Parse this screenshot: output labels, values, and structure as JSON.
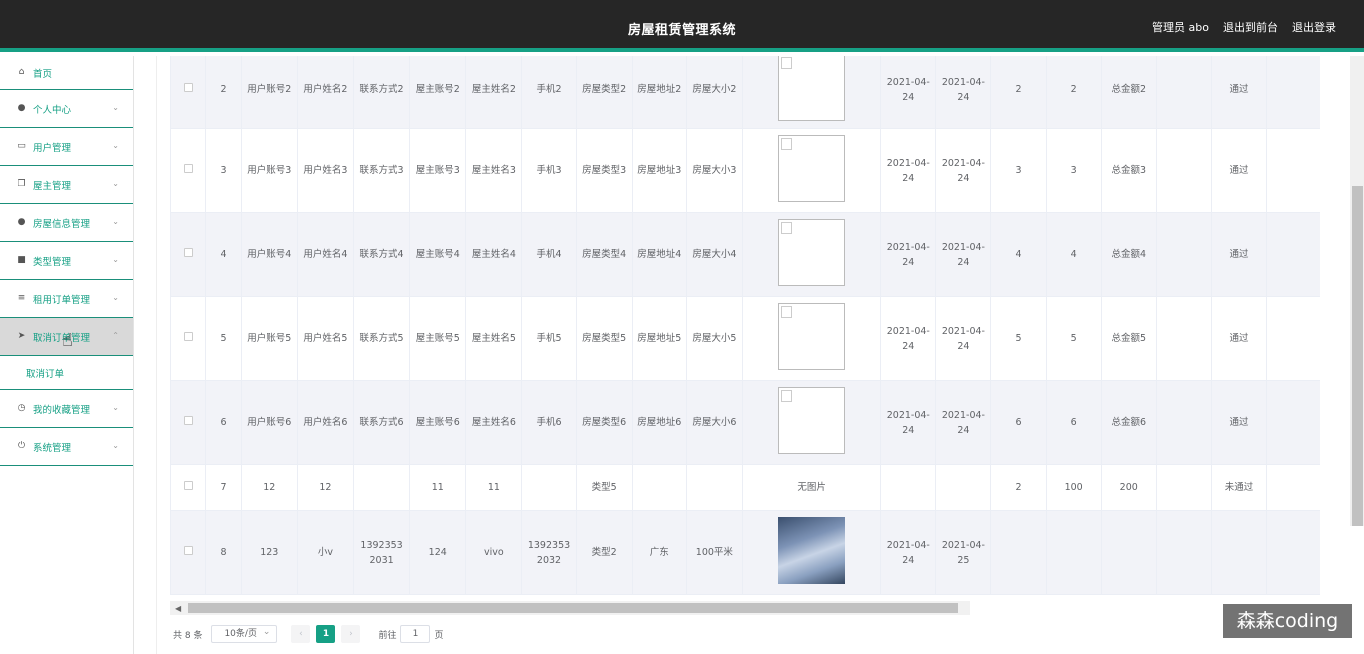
{
  "header": {
    "title": "房屋租赁管理系统",
    "admin": "管理员 abo",
    "to_front": "退出到前台",
    "logout": "退出登录"
  },
  "sidebar": {
    "items": [
      {
        "label": "首页",
        "icon": "home-icon"
      },
      {
        "label": "个人中心",
        "icon": "user-icon"
      },
      {
        "label": "用户管理",
        "icon": "card-icon"
      },
      {
        "label": "屋主管理",
        "icon": "copy-icon"
      },
      {
        "label": "房屋信息管理",
        "icon": "person-icon"
      },
      {
        "label": "类型管理",
        "icon": "briefcase-icon"
      },
      {
        "label": "租用订单管理",
        "icon": "sliders-icon"
      },
      {
        "label": "取消订单管理",
        "icon": "send-icon"
      },
      {
        "label": "我的收藏管理",
        "icon": "clock-icon"
      },
      {
        "label": "系统管理",
        "icon": "power-icon"
      }
    ],
    "submenu_label": "取消订单"
  },
  "table": {
    "rows": [
      {
        "idx": "2",
        "c1": "用户账号2",
        "c2": "用户姓名2",
        "c3": "联系方式2",
        "c4": "屋主账号2",
        "c5": "屋主姓名2",
        "c6": "手机2",
        "c7": "房屋类型2",
        "c8": "房屋地址2",
        "c9": "房屋大小2",
        "img": "broken",
        "d1": "2021-04-24",
        "d2": "2021-04-24",
        "n1": "2",
        "n2": "2",
        "total": "总金额2",
        "c10": "",
        "status": "通过"
      },
      {
        "idx": "3",
        "c1": "用户账号3",
        "c2": "用户姓名3",
        "c3": "联系方式3",
        "c4": "屋主账号3",
        "c5": "屋主姓名3",
        "c6": "手机3",
        "c7": "房屋类型3",
        "c8": "房屋地址3",
        "c9": "房屋大小3",
        "img": "broken",
        "d1": "2021-04-24",
        "d2": "2021-04-24",
        "n1": "3",
        "n2": "3",
        "total": "总金额3",
        "c10": "",
        "status": "通过"
      },
      {
        "idx": "4",
        "c1": "用户账号4",
        "c2": "用户姓名4",
        "c3": "联系方式4",
        "c4": "屋主账号4",
        "c5": "屋主姓名4",
        "c6": "手机4",
        "c7": "房屋类型4",
        "c8": "房屋地址4",
        "c9": "房屋大小4",
        "img": "broken",
        "d1": "2021-04-24",
        "d2": "2021-04-24",
        "n1": "4",
        "n2": "4",
        "total": "总金额4",
        "c10": "",
        "status": "通过"
      },
      {
        "idx": "5",
        "c1": "用户账号5",
        "c2": "用户姓名5",
        "c3": "联系方式5",
        "c4": "屋主账号5",
        "c5": "屋主姓名5",
        "c6": "手机5",
        "c7": "房屋类型5",
        "c8": "房屋地址5",
        "c9": "房屋大小5",
        "img": "broken",
        "d1": "2021-04-24",
        "d2": "2021-04-24",
        "n1": "5",
        "n2": "5",
        "total": "总金额5",
        "c10": "",
        "status": "通过"
      },
      {
        "idx": "6",
        "c1": "用户账号6",
        "c2": "用户姓名6",
        "c3": "联系方式6",
        "c4": "屋主账号6",
        "c5": "屋主姓名6",
        "c6": "手机6",
        "c7": "房屋类型6",
        "c8": "房屋地址6",
        "c9": "房屋大小6",
        "img": "broken",
        "d1": "2021-04-24",
        "d2": "2021-04-24",
        "n1": "6",
        "n2": "6",
        "total": "总金额6",
        "c10": "",
        "status": "通过"
      },
      {
        "idx": "7",
        "c1": "12",
        "c2": "12",
        "c3": "",
        "c4": "11",
        "c5": "11",
        "c6": "",
        "c7": "类型5",
        "c8": "",
        "c9": "",
        "img": "none",
        "img_text": "无图片",
        "d1": "",
        "d2": "",
        "n1": "2",
        "n2": "100",
        "total": "200",
        "c10": "",
        "status": "未通过"
      },
      {
        "idx": "8",
        "c1": "123",
        "c2": "小v",
        "c3": "13923532031",
        "c4": "124",
        "c5": "vivo",
        "c6": "13923532032",
        "c7": "类型2",
        "c8": "广东",
        "c9": "100平米",
        "img": "photo",
        "d1": "2021-04-24",
        "d2": "2021-04-25",
        "n1": "",
        "n2": "",
        "total": "",
        "c10": "",
        "status": ""
      }
    ],
    "op_icon": "edit-icon"
  },
  "pagination": {
    "total": "共 8 条",
    "page_size": "10条/页",
    "current": "1",
    "goto_label": "前往",
    "goto_value": "1",
    "page_unit": "页"
  },
  "watermark": "森森coding",
  "colors": {
    "accent": "#16a085",
    "header_bg": "#262626"
  }
}
